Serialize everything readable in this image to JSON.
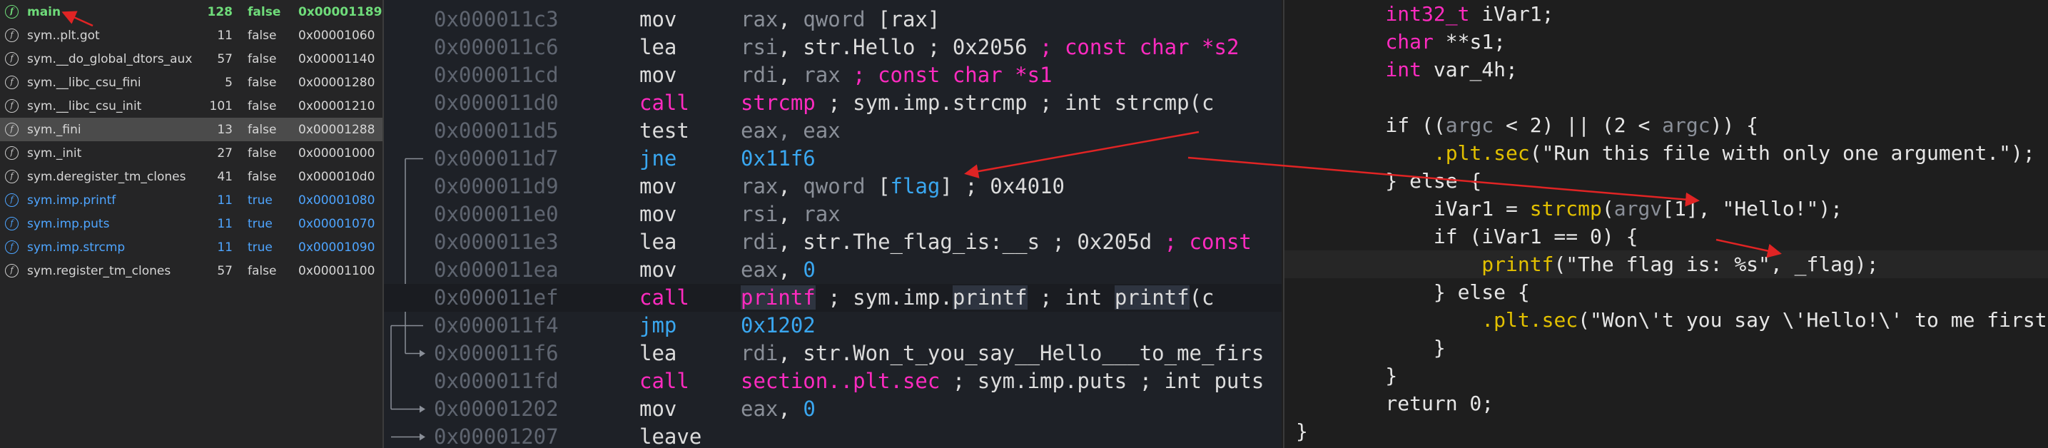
{
  "functions": [
    {
      "name": "main",
      "size": "128",
      "imported": "false",
      "address": "0x00001189",
      "kind": "main"
    },
    {
      "name": "sym..plt.got",
      "size": "11",
      "imported": "false",
      "address": "0x00001060",
      "kind": "normal"
    },
    {
      "name": "sym.__do_global_dtors_aux",
      "size": "57",
      "imported": "false",
      "address": "0x00001140",
      "kind": "normal"
    },
    {
      "name": "sym.__libc_csu_fini",
      "size": "5",
      "imported": "false",
      "address": "0x00001280",
      "kind": "normal"
    },
    {
      "name": "sym.__libc_csu_init",
      "size": "101",
      "imported": "false",
      "address": "0x00001210",
      "kind": "normal"
    },
    {
      "name": "sym._fini",
      "size": "13",
      "imported": "false",
      "address": "0x00001288",
      "kind": "selected"
    },
    {
      "name": "sym._init",
      "size": "27",
      "imported": "false",
      "address": "0x00001000",
      "kind": "normal"
    },
    {
      "name": "sym.deregister_tm_clones",
      "size": "41",
      "imported": "false",
      "address": "0x000010d0",
      "kind": "normal"
    },
    {
      "name": "sym.imp.printf",
      "size": "11",
      "imported": "true",
      "address": "0x00001080",
      "kind": "import"
    },
    {
      "name": "sym.imp.puts",
      "size": "11",
      "imported": "true",
      "address": "0x00001070",
      "kind": "import"
    },
    {
      "name": "sym.imp.strcmp",
      "size": "11",
      "imported": "true",
      "address": "0x00001090",
      "kind": "import"
    },
    {
      "name": "sym.register_tm_clones",
      "size": "57",
      "imported": "false",
      "address": "0x00001100",
      "kind": "normal"
    }
  ],
  "function_icon_glyph": "f",
  "disasm": [
    {
      "addr": "0x000011c3",
      "mn": "mov",
      "mnc": "",
      "op": [
        {
          "t": "rax",
          "c": "t-reg"
        },
        {
          "t": ", ",
          "c": "t-plain"
        },
        {
          "t": "qword",
          "c": "t-reg"
        },
        {
          "t": " [rax]",
          "c": "t-plain"
        }
      ]
    },
    {
      "addr": "0x000011c6",
      "mn": "lea",
      "mnc": "",
      "op": [
        {
          "t": "rsi",
          "c": "t-reg"
        },
        {
          "t": ", str.Hello ; 0x2056 ",
          "c": "t-plain"
        },
        {
          "t": "; const char *s2",
          "c": "t-cmt"
        }
      ]
    },
    {
      "addr": "0x000011cd",
      "mn": "mov",
      "mnc": "",
      "op": [
        {
          "t": "rdi",
          "c": "t-reg"
        },
        {
          "t": ", ",
          "c": "t-plain"
        },
        {
          "t": "rax",
          "c": "t-reg"
        },
        {
          "t": "   ; const char *s1",
          "c": "t-cmt"
        }
      ]
    },
    {
      "addr": "0x000011d0",
      "mn": "call",
      "mnc": "mn-call",
      "op": [
        {
          "t": "strcmp",
          "c": "t-cmt"
        },
        {
          "t": "     ; sym.imp.strcmp ; int strcmp(c",
          "c": "t-plain"
        }
      ]
    },
    {
      "addr": "0x000011d5",
      "mn": "test",
      "mnc": "",
      "op": [
        {
          "t": "eax, eax",
          "c": "t-reg"
        }
      ]
    },
    {
      "addr": "0x000011d7",
      "mn": "jne",
      "mnc": "mn-jmp",
      "op": [
        {
          "t": "0x11f6",
          "c": "t-blue"
        }
      ]
    },
    {
      "addr": "0x000011d9",
      "mn": "mov",
      "mnc": "",
      "op": [
        {
          "t": "rax",
          "c": "t-reg"
        },
        {
          "t": ", ",
          "c": "t-plain"
        },
        {
          "t": "qword",
          "c": "t-reg"
        },
        {
          "t": " [",
          "c": "t-plain"
        },
        {
          "t": "flag",
          "c": "t-blue"
        },
        {
          "t": "] ; 0x4010",
          "c": "t-plain"
        }
      ]
    },
    {
      "addr": "0x000011e0",
      "mn": "mov",
      "mnc": "",
      "op": [
        {
          "t": "rsi",
          "c": "t-reg"
        },
        {
          "t": ", ",
          "c": "t-plain"
        },
        {
          "t": "rax",
          "c": "t-reg"
        }
      ]
    },
    {
      "addr": "0x000011e3",
      "mn": "lea",
      "mnc": "",
      "op": [
        {
          "t": "rdi",
          "c": "t-reg"
        },
        {
          "t": ", str.The_flag_is:__s ; 0x205d ",
          "c": "t-plain"
        },
        {
          "t": "; const",
          "c": "t-cmt"
        }
      ]
    },
    {
      "addr": "0x000011ea",
      "mn": "mov",
      "mnc": "",
      "op": [
        {
          "t": "eax",
          "c": "t-reg"
        },
        {
          "t": ", ",
          "c": "t-plain"
        },
        {
          "t": "0",
          "c": "t-blue"
        }
      ]
    },
    {
      "addr": "0x000011ef",
      "mn": "call",
      "mnc": "mn-call",
      "hl": true,
      "op": [
        {
          "t": "printf",
          "c": "t-cmt t-box"
        },
        {
          "t": "      ; sym.imp.",
          "c": "t-plain"
        },
        {
          "t": "printf",
          "c": "t-plain t-box"
        },
        {
          "t": " ; int ",
          "c": "t-plain"
        },
        {
          "t": "printf",
          "c": "t-plain t-box"
        },
        {
          "t": "(c",
          "c": "t-plain"
        }
      ]
    },
    {
      "addr": "0x000011f4",
      "mn": "jmp",
      "mnc": "mn-jmp",
      "op": [
        {
          "t": "0x1202",
          "c": "t-blue"
        }
      ]
    },
    {
      "addr": "0x000011f6",
      "mn": "lea",
      "mnc": "",
      "op": [
        {
          "t": "rdi",
          "c": "t-reg"
        },
        {
          "t": ", str.Won_t_you_say__Hello___to_me_firs",
          "c": "t-plain"
        }
      ]
    },
    {
      "addr": "0x000011fd",
      "mn": "call",
      "mnc": "mn-call",
      "op": [
        {
          "t": "section..plt.sec",
          "c": "t-cmt"
        },
        {
          "t": " ; sym.imp.puts ; int puts",
          "c": "t-plain"
        }
      ]
    },
    {
      "addr": "0x00001202",
      "mn": "mov",
      "mnc": "",
      "op": [
        {
          "t": "eax",
          "c": "t-reg"
        },
        {
          "t": ", ",
          "c": "t-plain"
        },
        {
          "t": "0",
          "c": "t-blue"
        }
      ]
    },
    {
      "addr": "0x00001207",
      "mn": "leave",
      "mnc": "",
      "op": []
    }
  ],
  "decomp": [
    {
      "parts": [
        {
          "t": "    ",
          "c": "k-plain"
        },
        {
          "t": "int32_t",
          "c": "k-type"
        },
        {
          "t": " iVar1;",
          "c": "k-plain"
        }
      ]
    },
    {
      "parts": [
        {
          "t": "    ",
          "c": "k-plain"
        },
        {
          "t": "char",
          "c": "k-type"
        },
        {
          "t": " **s1;",
          "c": "k-plain"
        }
      ]
    },
    {
      "parts": [
        {
          "t": "    ",
          "c": "k-plain"
        },
        {
          "t": "int",
          "c": "k-type"
        },
        {
          "t": " var_4h;",
          "c": "k-plain"
        }
      ]
    },
    {
      "parts": [
        {
          "t": "",
          "c": "k-plain"
        }
      ]
    },
    {
      "parts": [
        {
          "t": "    if ((",
          "c": "k-plain"
        },
        {
          "t": "argc",
          "c": "k-dim"
        },
        {
          "t": " < 2) || (2 < ",
          "c": "k-plain"
        },
        {
          "t": "argc",
          "c": "k-dim"
        },
        {
          "t": ")) {",
          "c": "k-plain"
        }
      ]
    },
    {
      "parts": [
        {
          "t": "        ",
          "c": "k-plain"
        },
        {
          "t": ".plt.sec",
          "c": "k-fn"
        },
        {
          "t": "(\"Run this file with only one argument.\");",
          "c": "k-str"
        }
      ]
    },
    {
      "parts": [
        {
          "t": "    } else {",
          "c": "k-plain"
        }
      ]
    },
    {
      "parts": [
        {
          "t": "        iVar1 = ",
          "c": "k-plain"
        },
        {
          "t": "strcmp",
          "c": "k-fn"
        },
        {
          "t": "(",
          "c": "k-plain"
        },
        {
          "t": "argv",
          "c": "k-dim"
        },
        {
          "t": "[1], \"Hello!\");",
          "c": "k-plain"
        }
      ]
    },
    {
      "parts": [
        {
          "t": "        if (iVar1 == 0) {",
          "c": "k-plain"
        }
      ]
    },
    {
      "hl": true,
      "parts": [
        {
          "t": "            ",
          "c": "k-plain"
        },
        {
          "t": "printf",
          "c": "k-fn"
        },
        {
          "t": "(\"The flag is: %s\", _flag);",
          "c": "k-plain"
        }
      ]
    },
    {
      "parts": [
        {
          "t": "        } else {",
          "c": "k-plain"
        }
      ]
    },
    {
      "parts": [
        {
          "t": "            ",
          "c": "k-plain"
        },
        {
          "t": ".plt.sec",
          "c": "k-fn"
        },
        {
          "t": "(\"Won\\'t you say \\'Hello!\\' to me first",
          "c": "k-str"
        }
      ]
    },
    {
      "parts": [
        {
          "t": "        }",
          "c": "k-plain"
        }
      ]
    },
    {
      "parts": [
        {
          "t": "    }",
          "c": "k-plain"
        }
      ]
    },
    {
      "parts": [
        {
          "t": "    return 0;",
          "c": "k-plain"
        }
      ]
    },
    {
      "parts": [
        {
          "t": "}",
          "c": "k-plain"
        }
      ]
    }
  ],
  "colors": {
    "annotation_arrow": "#e02424",
    "main_green": "#6fdc7a",
    "import_blue": "#4ea5ff",
    "call_pink": "#ff2bc0"
  }
}
